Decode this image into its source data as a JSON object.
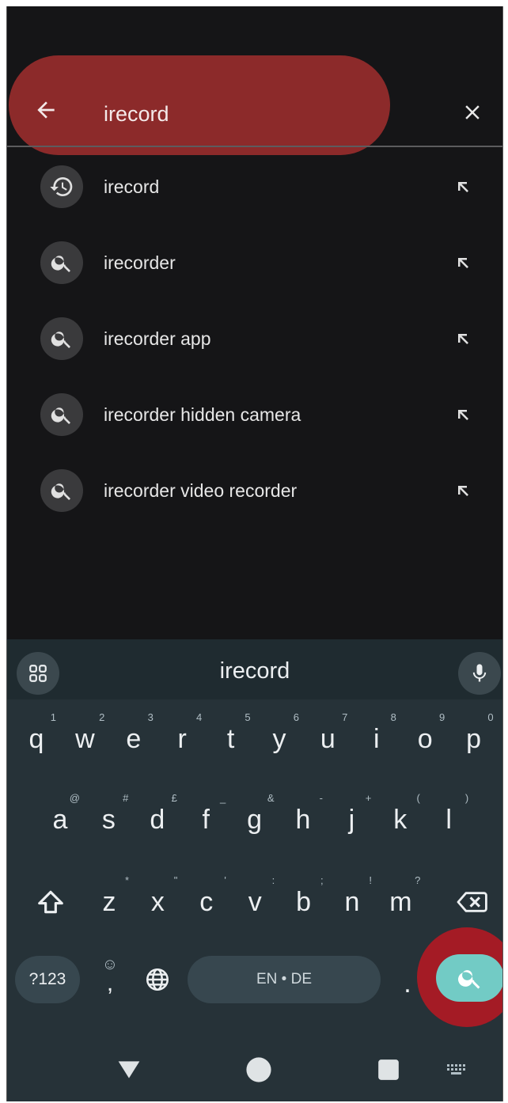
{
  "search": {
    "query": "irecord",
    "back_icon": "arrow-left-icon",
    "clear_icon": "close-icon"
  },
  "suggestions": [
    {
      "text": "irecord",
      "icon": "history-icon"
    },
    {
      "text": "irecorder",
      "icon": "search-icon"
    },
    {
      "text": "irecorder app",
      "icon": "search-icon"
    },
    {
      "text": "irecorder hidden camera",
      "icon": "search-icon"
    },
    {
      "text": "irecorder video recorder",
      "icon": "search-icon"
    }
  ],
  "keyboard": {
    "suggestion": "irecord",
    "row1": [
      {
        "k": "q",
        "h": "1"
      },
      {
        "k": "w",
        "h": "2"
      },
      {
        "k": "e",
        "h": "3"
      },
      {
        "k": "r",
        "h": "4"
      },
      {
        "k": "t",
        "h": "5"
      },
      {
        "k": "y",
        "h": "6"
      },
      {
        "k": "u",
        "h": "7"
      },
      {
        "k": "i",
        "h": "8"
      },
      {
        "k": "o",
        "h": "9"
      },
      {
        "k": "p",
        "h": "0"
      }
    ],
    "row2": [
      {
        "k": "a",
        "h": "@"
      },
      {
        "k": "s",
        "h": "#"
      },
      {
        "k": "d",
        "h": "£"
      },
      {
        "k": "f",
        "h": "_"
      },
      {
        "k": "g",
        "h": "&"
      },
      {
        "k": "h",
        "h": "-"
      },
      {
        "k": "j",
        "h": "+"
      },
      {
        "k": "k",
        "h": "("
      },
      {
        "k": "l",
        "h": ")"
      }
    ],
    "row3": [
      {
        "k": "z",
        "h": "*"
      },
      {
        "k": "x",
        "h": "\""
      },
      {
        "k": "c",
        "h": "'"
      },
      {
        "k": "v",
        "h": ":"
      },
      {
        "k": "b",
        "h": ";"
      },
      {
        "k": "n",
        "h": "!"
      },
      {
        "k": "m",
        "h": "?"
      }
    ],
    "symbols_label": "?123",
    "emoji_hint": "☺",
    "comma": ",",
    "space_label": "EN • DE",
    "period": "."
  },
  "colors": {
    "background": "#151517",
    "keyboard_bg": "#263238",
    "search_key": "#72cbc5",
    "annotation_red": "#a41b25"
  }
}
